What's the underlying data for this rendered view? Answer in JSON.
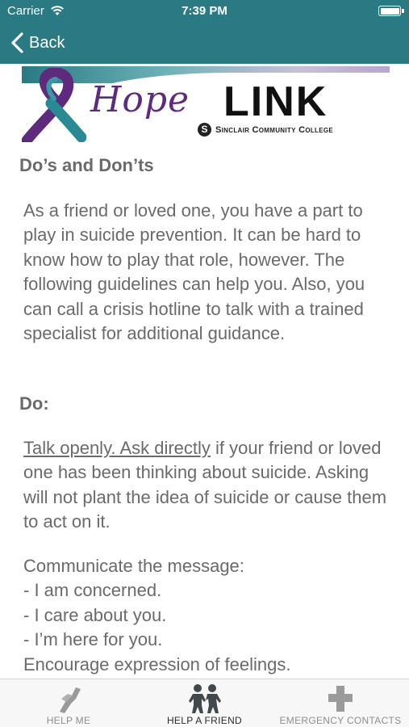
{
  "status_bar": {
    "carrier": "Carrier",
    "time": "7:39 PM"
  },
  "nav": {
    "back_label": "Back"
  },
  "banner": {
    "hope_text": "Hope",
    "link_text": "LINK",
    "college_text": "Sinclair Community College"
  },
  "article": {
    "title": "Do’s and Don’ts",
    "intro": "As a friend or loved one, you have a part to play in suicide prevention. It can be hard to know how to play that role, however. The following guidelines can help you. Also, you can call a crisis hotline to talk with a trained specialist for additional guidance.",
    "do_heading": "Do:",
    "do_p1_underlined": "Talk openly. Ask directly",
    "do_p1_rest": " if your friend or loved one has been thinking about suicide. Asking will not plant the idea of suicide or cause them to act on it.",
    "do_p2_lines": [
      "Communicate the message:",
      "- I am concerned.",
      "- I care about you.",
      "- I’m here for you.",
      "Encourage expression of feelings."
    ]
  },
  "tabs": [
    {
      "label": "HELP ME",
      "icon": "helping-hand-icon",
      "active": false
    },
    {
      "label": "HELP A FRIEND",
      "icon": "friends-icon",
      "active": true
    },
    {
      "label": "EMERGENCY CONTACTS",
      "icon": "medical-cross-icon",
      "active": false
    }
  ],
  "colors": {
    "header_teal": "#2a7a83",
    "body_text": "#6a6a6a",
    "hope_purple": "#5e2a7e"
  }
}
